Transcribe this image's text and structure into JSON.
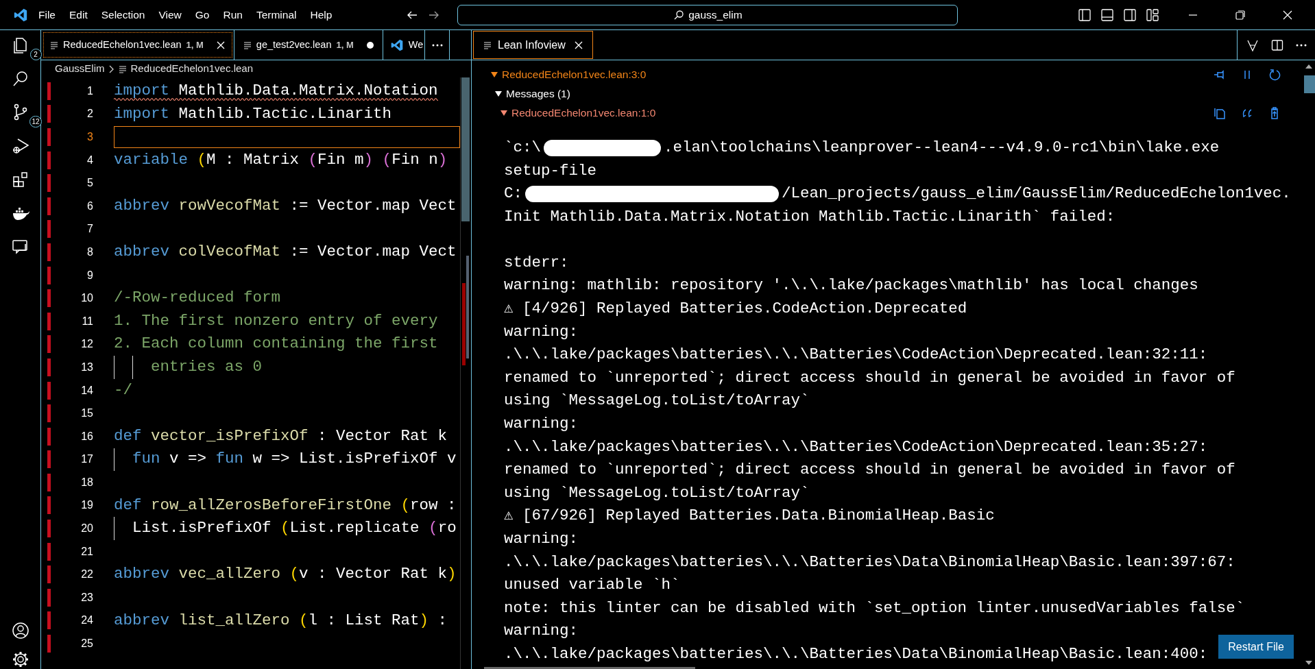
{
  "title_bar": {
    "menu": [
      "File",
      "Edit",
      "Selection",
      "View",
      "Go",
      "Run",
      "Terminal",
      "Help"
    ],
    "search_text": "gauss_elim"
  },
  "activity_bar": [
    {
      "kind": "explorer",
      "badge": "2"
    },
    {
      "kind": "search"
    },
    {
      "kind": "source-control",
      "badge": "12"
    },
    {
      "kind": "run-debug"
    },
    {
      "kind": "extensions"
    },
    {
      "kind": "docker"
    },
    {
      "kind": "remote"
    },
    {
      "kind": "account"
    },
    {
      "kind": "settings"
    }
  ],
  "editor_tabs": [
    {
      "label": "ReducedEchelon1vec.lean",
      "status": "1, M",
      "selected": true,
      "modified": false,
      "kind": "file"
    },
    {
      "label": "ge_test2vec.lean",
      "status": "1, M",
      "selected": false,
      "modified": true,
      "kind": "file"
    },
    {
      "label": "We",
      "selected": false,
      "kind": "welcome"
    }
  ],
  "breadcrumb": [
    "GaussElim",
    "ReducedEchelon1vec.lean"
  ],
  "code_lines": [
    {
      "number": "1",
      "error": true,
      "current": false,
      "tokens": [
        {
          "kind": "keyword",
          "text": "import"
        },
        {
          "kind": "plain",
          "text": " Mathlib.Data.Matrix.Notation"
        }
      ]
    },
    {
      "number": "2",
      "error": false,
      "current": false,
      "tokens": [
        {
          "kind": "keyword",
          "text": "import"
        },
        {
          "kind": "plain",
          "text": " Mathlib.Tactic.Linarith"
        }
      ]
    },
    {
      "number": "3",
      "error": false,
      "current": true
    },
    {
      "number": "4",
      "error": false,
      "current": false,
      "tokens": [
        {
          "kind": "keyword",
          "text": "variable"
        },
        {
          "kind": "bracket1",
          "text": " ("
        },
        {
          "kind": "plain",
          "text": "M : Matrix "
        },
        {
          "kind": "bracket2",
          "text": "("
        },
        {
          "kind": "plain",
          "text": "Fin m"
        },
        {
          "kind": "bracket2",
          "text": ") ("
        },
        {
          "kind": "plain",
          "text": "Fin n"
        },
        {
          "kind": "bracket2",
          "text": ")"
        }
      ]
    },
    {
      "number": "5",
      "error": false,
      "current": false
    },
    {
      "number": "6",
      "error": false,
      "current": false,
      "tokens": [
        {
          "kind": "keyword",
          "text": "abbrev"
        },
        {
          "kind": "name",
          "text": " rowVecofMat"
        },
        {
          "kind": "plain",
          "text": " := Vector.map Vect"
        }
      ]
    },
    {
      "number": "7",
      "error": false,
      "current": false
    },
    {
      "number": "8",
      "error": false,
      "current": false,
      "tokens": [
        {
          "kind": "keyword",
          "text": "abbrev"
        },
        {
          "kind": "name",
          "text": " colVecofMat"
        },
        {
          "kind": "plain",
          "text": " := Vector.map Vect"
        }
      ]
    },
    {
      "number": "9",
      "error": false,
      "current": false
    },
    {
      "number": "10",
      "error": false,
      "current": false,
      "tokens": [
        {
          "kind": "comment",
          "text": "/-Row-reduced form"
        }
      ]
    },
    {
      "number": "11",
      "error": false,
      "current": false,
      "tokens": [
        {
          "kind": "comment",
          "text": "1. The first nonzero entry of every"
        }
      ]
    },
    {
      "number": "12",
      "error": false,
      "current": false,
      "tokens": [
        {
          "kind": "comment",
          "text": "2. Each column containing the first"
        }
      ]
    },
    {
      "number": "13",
      "error": false,
      "current": false,
      "tokens": [
        {
          "kind": "comment",
          "text": "    entries as 0"
        }
      ]
    },
    {
      "number": "14",
      "error": false,
      "current": false,
      "tokens": [
        {
          "kind": "comment",
          "text": "-/"
        }
      ]
    },
    {
      "number": "15",
      "error": false,
      "current": false
    },
    {
      "number": "16",
      "error": false,
      "current": false,
      "tokens": [
        {
          "kind": "keyword",
          "text": "def"
        },
        {
          "kind": "name",
          "text": " vector_isPrefixOf"
        },
        {
          "kind": "plain",
          "text": " : Vector Rat k"
        }
      ]
    },
    {
      "number": "17",
      "error": false,
      "current": false,
      "tokens": [
        {
          "kind": "keyword",
          "text": "  fun"
        },
        {
          "kind": "plain",
          "text": " v => "
        },
        {
          "kind": "keyword",
          "text": "fun"
        },
        {
          "kind": "plain",
          "text": " w => List.isPrefixOf v"
        }
      ]
    },
    {
      "number": "18",
      "error": false,
      "current": false
    },
    {
      "number": "19",
      "error": false,
      "current": false,
      "tokens": [
        {
          "kind": "keyword",
          "text": "def"
        },
        {
          "kind": "name",
          "text": " row_allZerosBeforeFirstOne"
        },
        {
          "kind": "bracket1",
          "text": " ("
        },
        {
          "kind": "plain",
          "text": "row :"
        }
      ]
    },
    {
      "number": "20",
      "error": false,
      "current": false,
      "tokens": [
        {
          "kind": "plain",
          "text": "  List.isPrefixOf "
        },
        {
          "kind": "bracket1",
          "text": "("
        },
        {
          "kind": "plain",
          "text": "List.replicate "
        },
        {
          "kind": "bracket2",
          "text": "("
        },
        {
          "kind": "plain",
          "text": "ro"
        }
      ]
    },
    {
      "number": "21",
      "error": false,
      "current": false
    },
    {
      "number": "22",
      "error": false,
      "current": false,
      "tokens": [
        {
          "kind": "keyword",
          "text": "abbrev"
        },
        {
          "kind": "name",
          "text": " vec_allZero"
        },
        {
          "kind": "bracket1",
          "text": " ("
        },
        {
          "kind": "plain",
          "text": "v : Vector Rat k"
        },
        {
          "kind": "bracket1",
          "text": ")"
        }
      ]
    },
    {
      "number": "23",
      "error": false,
      "current": false
    },
    {
      "number": "24",
      "error": false,
      "current": false,
      "tokens": [
        {
          "kind": "keyword",
          "text": "abbrev"
        },
        {
          "kind": "name",
          "text": " list_allZero"
        },
        {
          "kind": "bracket1",
          "text": " ("
        },
        {
          "kind": "plain",
          "text": "l : List Rat"
        },
        {
          "kind": "bracket1",
          "text": ")"
        },
        {
          "kind": "plain",
          "text": " :"
        }
      ]
    },
    {
      "number": "25",
      "error": false,
      "current": false
    }
  ],
  "infoview": {
    "tabs": [
      {
        "label": "Lean Infoview",
        "selected": true
      }
    ],
    "goal_header": {
      "text": "ReducedEchelon1vec.lean:3:0",
      "expanded": true
    },
    "messages_header": {
      "text": "Messages (1)",
      "expanded": true
    },
    "message": {
      "location": "ReducedEchelon1vec.lean:1:0",
      "expanded": true,
      "lines": [
        {
          "segments": [
            "`c:\\",
            ".elan\\toolchains\\leanprover--lean4---v4.9.0-rc1\\bin\\lake.exe"
          ]
        },
        {
          "text": "setup-file"
        },
        {
          "segments": [
            "C:",
            "/Lean_projects/gauss_elim/GaussElim/ReducedEchelon1vec."
          ]
        },
        {
          "text": "Init Mathlib.Data.Matrix.Notation Mathlib.Tactic.Linarith` failed:"
        },
        {
          "text": "stderr:",
          "gap_before": true
        },
        {
          "text": "warning: mathlib: repository '.\\.\\.lake/packages\\mathlib' has local changes"
        },
        {
          "text": "⚠ [4/926] Replayed Batteries.CodeAction.Deprecated"
        },
        {
          "text": "warning:"
        },
        {
          "text": ".\\.\\.lake/packages\\batteries\\.\\.\\Batteries\\CodeAction\\Deprecated.lean:32:11:"
        },
        {
          "text": "renamed to `unreported`; direct access should in general be avoided in favor of"
        },
        {
          "text": "using `MessageLog.toList/toArray`"
        },
        {
          "text": "warning:"
        },
        {
          "text": ".\\.\\.lake/packages\\batteries\\.\\.\\Batteries\\CodeAction\\Deprecated.lean:35:27:"
        },
        {
          "text": "renamed to `unreported`; direct access should in general be avoided in favor of"
        },
        {
          "text": "using `MessageLog.toList/toArray`"
        },
        {
          "text": "⚠ [67/926] Replayed Batteries.Data.BinomialHeap.Basic"
        },
        {
          "text": "warning:"
        },
        {
          "text": ".\\.\\.lake/packages\\batteries\\.\\.\\Batteries\\Data\\BinomialHeap\\Basic.lean:397:67:"
        },
        {
          "text": "unused variable `h`"
        },
        {
          "text": "note: this linter can be disabled with `set_option linter.unusedVariables false`"
        },
        {
          "text": "warning:"
        },
        {
          "text": ".\\.\\.lake/packages\\batteries\\.\\.\\Batteries\\Data\\BinomialHeap\\Basic.lean:400:"
        }
      ]
    },
    "restart_button": "Restart File"
  }
}
